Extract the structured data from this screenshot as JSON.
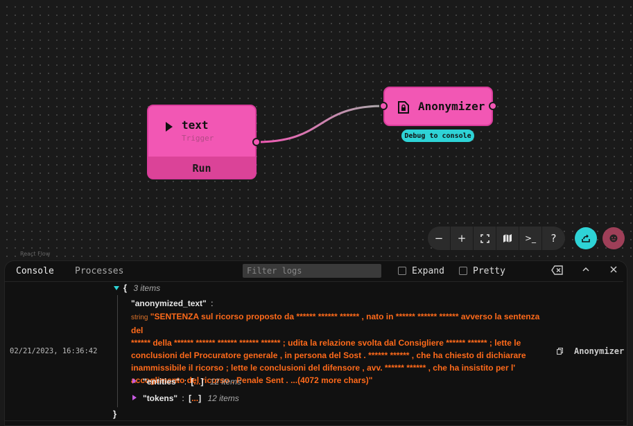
{
  "nodes": {
    "text": {
      "title": "text",
      "subtitle": "Trigger",
      "run_label": "Run"
    },
    "anonymizer": {
      "title": "Anonymizer",
      "badge": "Debug to console"
    }
  },
  "controls": {
    "zoom_out": "−",
    "zoom_in": "+",
    "help": "?",
    "terminal": ">_"
  },
  "watermark": "React Flow",
  "console": {
    "tabs": [
      "Console",
      "Processes"
    ],
    "filter_placeholder": "Filter logs",
    "expand_label": "Expand",
    "pretty_label": "Pretty",
    "log": {
      "timestamp": "02/21/2023, 16:36:42",
      "source": "Anonymizer",
      "open_brace": "{",
      "close_brace": "}",
      "item_count": "3 items",
      "anonymized_key": "\"anonymized_text\"",
      "colon": ":",
      "type": "string",
      "anonymized_lines": [
        "\"SENTENZA sul ricorso proposto da ****** ****** ****** , nato in ****** ****** ****** avverso la sentenza del",
        "****** della ****** ****** ****** ****** ****** ; udita la relazione svolta dal Consigliere ****** ****** ; lette le",
        "conclusioni del Procuratore generale , in persona del Sost . ****** ****** , che ha chiesto di dichiarare",
        "inammissibile il ricorso ; lette le conclusioni del difensore , avv. ****** ****** , che ha insistito per l'",
        "accoglimento del ricorso . Penale Sent . ...(4072 more chars)\""
      ],
      "entities_key": "\"entities\"",
      "entities_count": "12 items",
      "tokens_key": "\"tokens\"",
      "tokens_count": "12 items",
      "open_bracket": "[",
      "close_bracket": "]",
      "ellipsis": "..."
    }
  },
  "colors": {
    "node": "#f257b4",
    "accent": "#2ed3d6",
    "string": "#ff6a1a",
    "avatar": "#9e3f58"
  }
}
